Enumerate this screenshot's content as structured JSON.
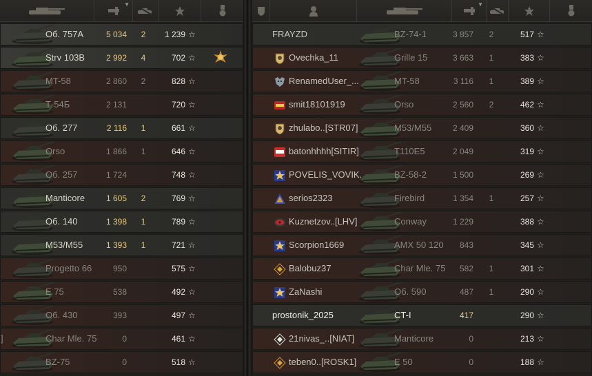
{
  "left": {
    "rows": [
      {
        "tank": "Об. 757А",
        "damage": "5 034",
        "kills": "2",
        "xp": "1 239",
        "style": "hl",
        "name_style": "bright",
        "dmg_style": "gold",
        "medal": false
      },
      {
        "tank": "Strv 103B",
        "damage": "2 992",
        "kills": "4",
        "xp": "702",
        "style": "hl",
        "name_style": "bright",
        "dmg_style": "gold",
        "medal": true
      },
      {
        "tank": "MT-58",
        "damage": "2 860",
        "kills": "2",
        "xp": "828",
        "style": "alt",
        "name_style": "dim",
        "dmg_style": "dim",
        "medal": false
      },
      {
        "tank": "Т-54Б",
        "damage": "2 131",
        "kills": "",
        "xp": "720",
        "style": "alt",
        "name_style": "dim",
        "dmg_style": "dim",
        "medal": false
      },
      {
        "tank": "Об. 277",
        "damage": "2 116",
        "kills": "1",
        "xp": "661",
        "style": "hl2",
        "name_style": "bright",
        "dmg_style": "gold",
        "medal": false
      },
      {
        "tank": "Orso",
        "damage": "1 866",
        "kills": "1",
        "xp": "646",
        "style": "alt",
        "name_style": "dim",
        "dmg_style": "dim",
        "medal": false
      },
      {
        "tank": "Об. 257",
        "damage": "1 724",
        "kills": "",
        "xp": "748",
        "style": "alt",
        "name_style": "dim",
        "dmg_style": "dim",
        "medal": false
      },
      {
        "tank": "Manticore",
        "damage": "1 605",
        "kills": "2",
        "xp": "769",
        "style": "hl2",
        "name_style": "bright",
        "dmg_style": "gold",
        "medal": false
      },
      {
        "tank": "Об. 140",
        "damage": "1 398",
        "kills": "1",
        "xp": "789",
        "style": "hl2",
        "name_style": "bright",
        "dmg_style": "gold",
        "medal": false
      },
      {
        "tank": "M53/M55",
        "damage": "1 393",
        "kills": "1",
        "xp": "721",
        "style": "hl2",
        "name_style": "bright",
        "dmg_style": "gold",
        "medal": false
      },
      {
        "tank": "Progetto 66",
        "damage": "950",
        "kills": "",
        "xp": "575",
        "style": "alt",
        "name_style": "dim",
        "dmg_style": "dim",
        "medal": false
      },
      {
        "tank": "E 75",
        "damage": "538",
        "kills": "",
        "xp": "492",
        "style": "alt",
        "name_style": "dim",
        "dmg_style": "dim",
        "medal": false
      },
      {
        "tank": "Об. 430",
        "damage": "393",
        "kills": "",
        "xp": "497",
        "style": "alt",
        "name_style": "dim",
        "dmg_style": "dim",
        "medal": false
      },
      {
        "tank": "Char Mle. 75",
        "damage": "0",
        "kills": "",
        "xp": "461",
        "style": "alt",
        "name_style": "dim",
        "dmg_style": "dim",
        "medal": false,
        "bracket": "]"
      },
      {
        "tank": "BZ-75",
        "damage": "0",
        "kills": "",
        "xp": "518",
        "style": "alt",
        "name_style": "dim",
        "dmg_style": "dim",
        "medal": false
      }
    ]
  },
  "right": {
    "rows": [
      {
        "player": "FRAYZD",
        "clan": "",
        "tank": "BZ-74-1",
        "damage": "3 857",
        "kills": "2",
        "xp": "517",
        "style": "hl2",
        "name_style": "dim",
        "dmg_style": "dim"
      },
      {
        "player": "Ovechka_11",
        "clan": "shield-gold",
        "tank": "Grille 15",
        "damage": "3 663",
        "kills": "1",
        "xp": "383",
        "style": "alt",
        "name_style": "dim",
        "dmg_style": "dim"
      },
      {
        "player": "RenamedUser_...",
        "clan": "wolf",
        "tank": "MT-58",
        "damage": "3 116",
        "kills": "1",
        "xp": "389",
        "style": "alt",
        "name_style": "dim",
        "dmg_style": "dim"
      },
      {
        "player": "smit18101919",
        "clan": "red-badge",
        "tank": "Orso",
        "damage": "2 560",
        "kills": "2",
        "xp": "462",
        "style": "alt",
        "name_style": "dim",
        "dmg_style": "dim"
      },
      {
        "player": "zhulabo..[STR07]",
        "clan": "shield-gold",
        "tank": "M53/M55",
        "damage": "2 409",
        "kills": "",
        "xp": "360",
        "style": "alt",
        "name_style": "dim",
        "dmg_style": "dim"
      },
      {
        "player": "batonhhhh[SITIR]",
        "clan": "ledwa",
        "tank": "T110E5",
        "damage": "2 049",
        "kills": "",
        "xp": "319",
        "style": "alt",
        "name_style": "dim",
        "dmg_style": "dim"
      },
      {
        "player": "POVELIS_VOVIK..",
        "clan": "blue-star",
        "tank": "BZ-58-2",
        "damage": "1 500",
        "kills": "",
        "xp": "269",
        "style": "alt",
        "name_style": "dim",
        "dmg_style": "dim"
      },
      {
        "player": "serios2323",
        "clan": "blue-triangle",
        "tank": "Firebird",
        "damage": "1 354",
        "kills": "1",
        "xp": "257",
        "style": "alt",
        "name_style": "dim",
        "dmg_style": "dim"
      },
      {
        "player": "Kuznetzov..[LHV]",
        "clan": "red-eye",
        "tank": "Conway",
        "damage": "1 229",
        "kills": "",
        "xp": "388",
        "style": "alt",
        "name_style": "dim",
        "dmg_style": "dim"
      },
      {
        "player": "Scorpion1669",
        "clan": "blue-star",
        "tank": "AMX 50 120",
        "damage": "843",
        "kills": "",
        "xp": "345",
        "style": "alt",
        "name_style": "dim",
        "dmg_style": "dim"
      },
      {
        "player": "Balobuz37",
        "clan": "orange-diamond",
        "tank": "Char Mle. 75",
        "damage": "582",
        "kills": "1",
        "xp": "301",
        "style": "alt",
        "name_style": "dim",
        "dmg_style": "dim"
      },
      {
        "player": "ZaNashi",
        "clan": "blue-star",
        "tank": "Об. 590",
        "damage": "487",
        "kills": "1",
        "xp": "290",
        "style": "alt",
        "name_style": "dim",
        "dmg_style": "dim"
      },
      {
        "player": "prostonik_2025",
        "clan": "",
        "tank": "CT-I",
        "damage": "417",
        "kills": "",
        "xp": "290",
        "style": "hl2",
        "name_style": "white",
        "dmg_style": "gold"
      },
      {
        "player": "21nivas_..[NIAT]",
        "clan": "white-diamond",
        "tank": "Manticore",
        "damage": "0",
        "kills": "",
        "xp": "213",
        "style": "alt",
        "name_style": "dim",
        "dmg_style": "dim"
      },
      {
        "player": "teben0..[ROSK1]",
        "clan": "orange-diamond",
        "tank": "E 50",
        "damage": "0",
        "kills": "",
        "xp": "188",
        "style": "alt",
        "name_style": "dim",
        "dmg_style": "dim"
      }
    ]
  },
  "icons": {
    "star": "☆",
    "sort": "▼"
  }
}
